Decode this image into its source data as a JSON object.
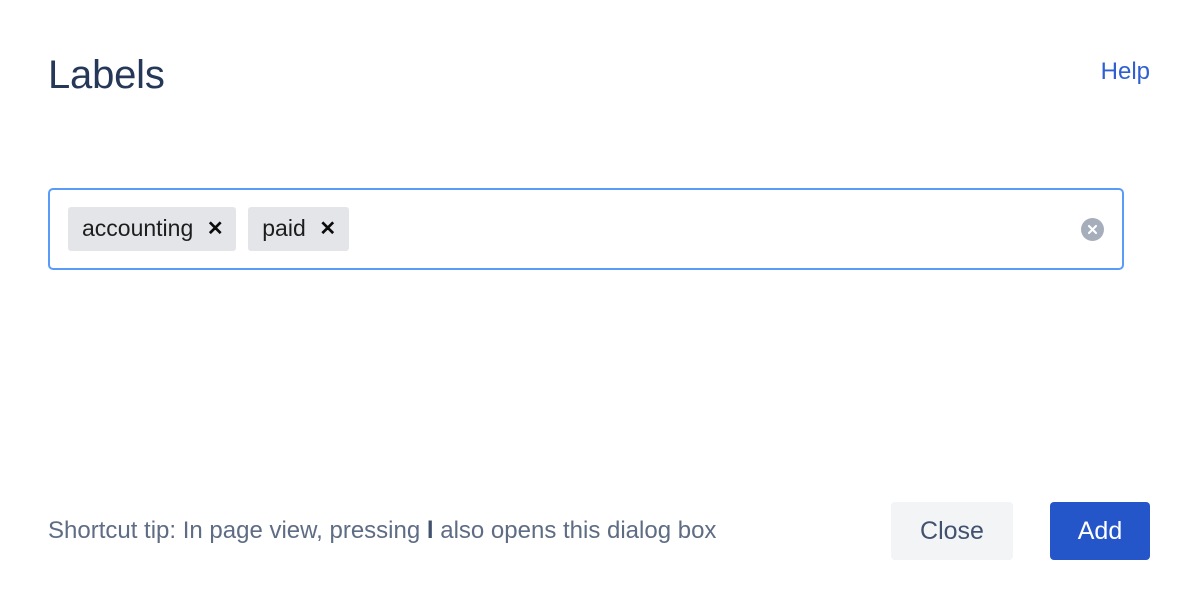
{
  "header": {
    "title": "Labels",
    "help_label": "Help"
  },
  "field": {
    "placeholder": "",
    "value": "",
    "clear_all_icon": "clear-circle-icon",
    "tags": [
      {
        "label": "accounting",
        "remove_icon": "close-icon",
        "remove_glyph": "✕"
      },
      {
        "label": "paid",
        "remove_icon": "close-icon",
        "remove_glyph": "✕"
      }
    ]
  },
  "footer": {
    "shortcut_tip_prefix": "Shortcut tip: In page view, pressing ",
    "shortcut_key": "l",
    "shortcut_tip_suffix": " also opens this dialog box",
    "close_label": "Close",
    "add_label": "Add"
  },
  "colors": {
    "title": "#253858",
    "link": "#2f5fd0",
    "input_border_focus": "#5b9bf8",
    "tag_background": "#e3e5e9",
    "clear_icon": "#a7aebb",
    "tip_text": "#5e6c84",
    "secondary_button_background": "#f3f4f6",
    "primary_button_background": "#2455c9",
    "page_background": "#ffffff"
  }
}
